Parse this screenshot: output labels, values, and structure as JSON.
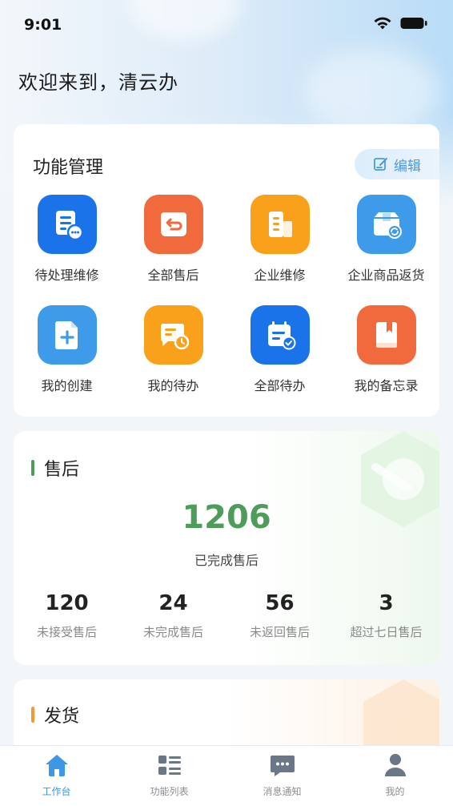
{
  "status_bar": {
    "time": "9:01"
  },
  "welcome": "欢迎来到，清云办",
  "functions": {
    "title": "功能管理",
    "edit_label": "编辑",
    "items": [
      {
        "label": "待处理维修",
        "icon": "pending-repair-icon",
        "color": "#1a73e8"
      },
      {
        "label": "全部售后",
        "icon": "after-sales-icon",
        "color": "#f06a3d"
      },
      {
        "label": "企业维修",
        "icon": "enterprise-repair-icon",
        "color": "#f9a11b"
      },
      {
        "label": "企业商品返货",
        "icon": "goods-return-icon",
        "color": "#3d9be9"
      },
      {
        "label": "我的创建",
        "icon": "my-create-icon",
        "color": "#3d9be9"
      },
      {
        "label": "我的待办",
        "icon": "my-todo-icon",
        "color": "#f9a11b"
      },
      {
        "label": "全部待办",
        "icon": "all-todo-icon",
        "color": "#1a73e8"
      },
      {
        "label": "我的备忘录",
        "icon": "memo-icon",
        "color": "#f06a3d"
      }
    ]
  },
  "after_sales": {
    "title": "售后",
    "accent": "#4d9c5a",
    "completed_value": "1206",
    "completed_label": "已完成售后",
    "stats": [
      {
        "value": "120",
        "label": "未接受售后"
      },
      {
        "value": "24",
        "label": "未完成售后"
      },
      {
        "value": "56",
        "label": "未返回售后"
      },
      {
        "value": "3",
        "label": "超过七日售后"
      }
    ]
  },
  "shipping": {
    "title": "发货",
    "accent": "#f39b32"
  },
  "tabbar": {
    "active_color": "#3d96e6",
    "items": [
      {
        "label": "工作台",
        "icon": "home-icon",
        "active": true
      },
      {
        "label": "功能列表",
        "icon": "grid-list-icon",
        "active": false
      },
      {
        "label": "消息通知",
        "icon": "message-icon",
        "active": false
      },
      {
        "label": "我的",
        "icon": "person-icon",
        "active": false
      }
    ]
  }
}
